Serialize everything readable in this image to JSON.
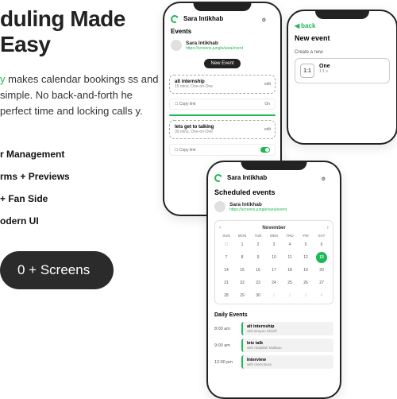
{
  "hero": {
    "headline_fragment": "duling Made Easy",
    "desc_prefix": "y",
    "desc_rest": " makes calendar bookings ss and simple. No back-and-forth he perfect time and locking calls y."
  },
  "features": [
    "r Management",
    "rms + Previews",
    "+ Fan Side",
    "odern UI"
  ],
  "cta_fragment": "0 + Screens",
  "phone1": {
    "header": "Sara Intikhab",
    "section": "Events",
    "user": {
      "name": "Sara Intikhab",
      "link": "https://screens.jungle/sara/event"
    },
    "new_event": "New Event",
    "event1": {
      "title": "alt internship",
      "sub": "15 mins, One-on-One",
      "edit": "edit",
      "copy": "Copy link",
      "toggle": "On"
    },
    "event2": {
      "title": "lets get to talking",
      "sub": "30 mins, One-on-One",
      "edit": "edit",
      "copy": "Copy link"
    }
  },
  "phone2": {
    "back": "back",
    "title": "New event",
    "create": "Create a new",
    "type": {
      "icon": "1:1",
      "name": "One",
      "desc": "1:1 s"
    }
  },
  "phone3": {
    "header": "Sara Intikhab",
    "title": "Scheduled events",
    "user": {
      "name": "Sara Intikhab",
      "link": "https://screens.jungle/sara/event"
    },
    "calendar": {
      "month": "November",
      "dow": [
        "SUN",
        "MON",
        "TUE",
        "WED",
        "THU",
        "FRI",
        "SAT"
      ],
      "prev_days": [
        31
      ],
      "days": [
        1,
        2,
        3,
        4,
        5,
        6,
        7,
        8,
        9,
        10,
        11,
        12,
        13,
        14,
        15,
        16,
        17,
        18,
        19,
        20,
        21,
        22,
        23,
        24,
        25,
        26,
        27,
        28,
        29,
        30
      ],
      "next_days": [
        1,
        2,
        3,
        4
      ],
      "selected": 13
    },
    "daily_title": "Daily Events",
    "daily": [
      {
        "time": "8:00 am",
        "name": "alt internship",
        "with": "with Brayan Shariff"
      },
      {
        "time": "9:00 am",
        "name": "letz talk",
        "with": "with Abdallah Malibau"
      },
      {
        "time": "12:00 pm",
        "name": "Interview",
        "with": "with client Boss"
      }
    ]
  }
}
